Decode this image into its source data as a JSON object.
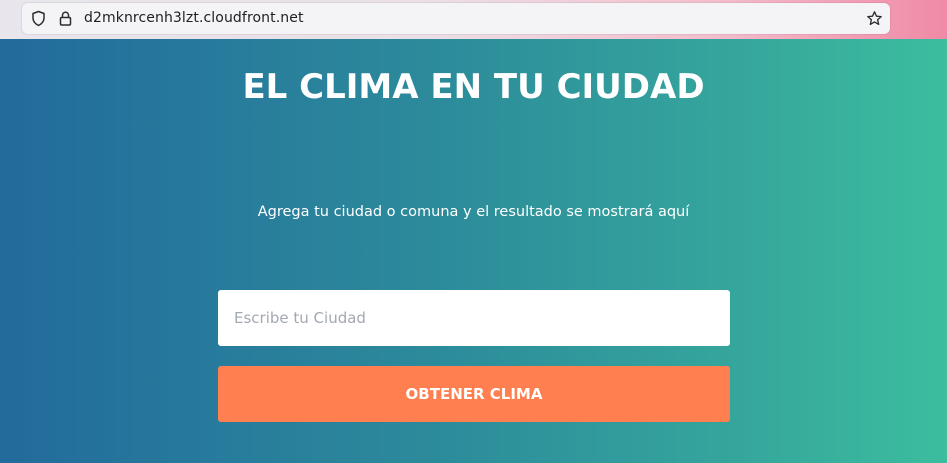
{
  "browser": {
    "url": "d2mknrcenh3lzt.cloudfront.net",
    "icons": {
      "shield": "shield-icon",
      "lock": "lock-icon",
      "bookmark": "star-icon"
    }
  },
  "page": {
    "title": "EL CLIMA EN TU CIUDAD",
    "subtitle": "Agrega tu ciudad o comuna y el resultado se mostrará aquí",
    "search": {
      "placeholder": "Escribe tu Ciudad",
      "value": ""
    },
    "submit_label": "OBTENER CLIMA"
  },
  "colors": {
    "gradient_start": "#226b9c",
    "gradient_end": "#3cbd9f",
    "button": "#ff7f50",
    "text": "#ffffff"
  }
}
